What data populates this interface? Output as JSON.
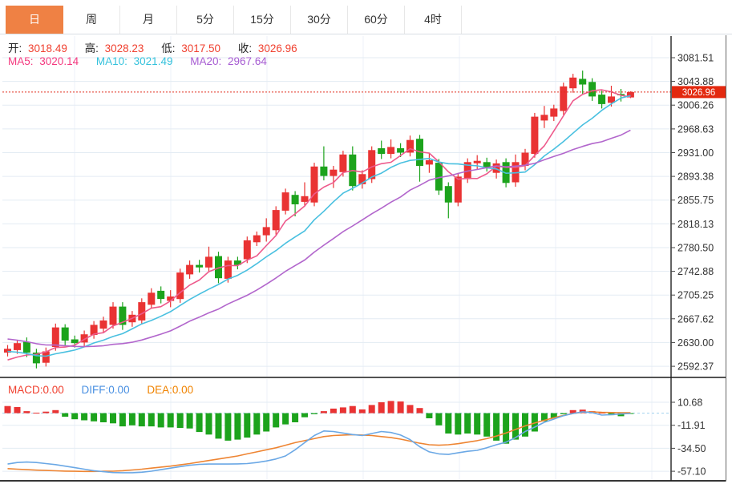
{
  "tabs": [
    {
      "name": "tab-day",
      "label": "日",
      "active": true
    },
    {
      "name": "tab-week",
      "label": "周",
      "active": false
    },
    {
      "name": "tab-month",
      "label": "月",
      "active": false
    },
    {
      "name": "tab-5min",
      "label": "5分",
      "active": false
    },
    {
      "name": "tab-15min",
      "label": "15分",
      "active": false
    },
    {
      "name": "tab-30min",
      "label": "30分",
      "active": false
    },
    {
      "name": "tab-60min",
      "label": "60分",
      "active": false
    },
    {
      "name": "tab-4hour",
      "label": "4时",
      "active": false
    }
  ],
  "info": {
    "ohlc": [
      {
        "label": "开:",
        "value": "3018.49"
      },
      {
        "label": "高:",
        "value": "3028.23"
      },
      {
        "label": "低:",
        "value": "3017.50"
      },
      {
        "label": "收:",
        "value": "3026.96"
      }
    ],
    "ma": [
      {
        "label": "MA5:",
        "value": "3020.14"
      },
      {
        "label": "MA10:",
        "value": "3021.49"
      },
      {
        "label": "MA20:",
        "value": "2967.64"
      }
    ]
  },
  "colors": {
    "tab_active": "#ef8144",
    "up": "#e93333",
    "down": "#1ca31c",
    "ohlc_value": "#f0402f",
    "ma5": "#f4387e",
    "ma10": "#35c2dc",
    "ma20": "#a65bd2",
    "ma5_line": "#ee5a8c",
    "ma10_line": "#49c0e0",
    "ma20_line": "#b266cc",
    "macd_label": "#f0402f",
    "diff_label": "#4a90e2",
    "dea_label": "#f08300",
    "diff_line": "#6ba8e5",
    "dea_line": "#ee8533",
    "price_line": "#e22f1e",
    "badge_bg": "#e3290f",
    "grid": "#e3ebf3",
    "vgrid": "#edf2f8",
    "zero_dash": "#9fd0ee",
    "axis_text": "#333333",
    "border": "#1a1a1a"
  },
  "chart_data": {
    "type": "candlestick+macd",
    "title": "",
    "main": {
      "y_axis_labels": [
        "3081.51",
        "3043.88",
        "3006.26",
        "2968.63",
        "2931.00",
        "2893.38",
        "2855.75",
        "2818.13",
        "2780.50",
        "2742.88",
        "2705.25",
        "2667.62",
        "2630.00",
        "2592.37"
      ],
      "ylim": [
        2592.37,
        3081.51
      ],
      "last_price": "3026.96",
      "last_price_value": 3026.96,
      "ma_series": [
        {
          "name": "MA5",
          "period": 5,
          "value": "3020.14"
        },
        {
          "name": "MA10",
          "period": 10,
          "value": "3021.49"
        },
        {
          "name": "MA20",
          "period": 20,
          "value": "2967.64"
        }
      ],
      "prehistory_closes": [
        2664,
        2662,
        2660,
        2658,
        2656,
        2654,
        2652,
        2650,
        2648,
        2646,
        2642,
        2636,
        2630,
        2624,
        2616,
        2606,
        2598,
        2592,
        2596
      ],
      "candles_format": [
        "open",
        "close",
        "low",
        "high"
      ],
      "candles": [
        [
          2614,
          2620,
          2608,
          2626
        ],
        [
          2618,
          2629,
          2612,
          2634
        ],
        [
          2631,
          2614,
          2607,
          2638
        ],
        [
          2614,
          2597,
          2589,
          2620
        ],
        [
          2598,
          2616,
          2592,
          2622
        ],
        [
          2623,
          2654,
          2617,
          2660
        ],
        [
          2654,
          2633,
          2625,
          2659
        ],
        [
          2635,
          2629,
          2622,
          2641
        ],
        [
          2630,
          2643,
          2624,
          2649
        ],
        [
          2642,
          2658,
          2636,
          2664
        ],
        [
          2652,
          2665,
          2646,
          2671
        ],
        [
          2658,
          2687,
          2652,
          2694
        ],
        [
          2687,
          2658,
          2650,
          2694
        ],
        [
          2662,
          2674,
          2655,
          2680
        ],
        [
          2665,
          2694,
          2659,
          2700
        ],
        [
          2690,
          2709,
          2684,
          2716
        ],
        [
          2712,
          2699,
          2692,
          2719
        ],
        [
          2696,
          2703,
          2686,
          2713
        ],
        [
          2699,
          2741,
          2693,
          2747
        ],
        [
          2738,
          2753,
          2731,
          2760
        ],
        [
          2753,
          2749,
          2741,
          2761
        ],
        [
          2749,
          2766,
          2743,
          2782
        ],
        [
          2767,
          2732,
          2724,
          2774
        ],
        [
          2731,
          2760,
          2725,
          2766
        ],
        [
          2760,
          2753,
          2746,
          2766
        ],
        [
          2762,
          2792,
          2756,
          2798
        ],
        [
          2789,
          2800,
          2783,
          2806
        ],
        [
          2800,
          2813,
          2790,
          2827
        ],
        [
          2808,
          2840,
          2801,
          2846
        ],
        [
          2839,
          2868,
          2833,
          2874
        ],
        [
          2864,
          2849,
          2830,
          2870
        ],
        [
          2853,
          2862,
          2847,
          2884
        ],
        [
          2852,
          2909,
          2846,
          2915
        ],
        [
          2909,
          2894,
          2887,
          2941
        ],
        [
          2894,
          2904,
          2875,
          2910
        ],
        [
          2900,
          2928,
          2893,
          2934
        ],
        [
          2928,
          2878,
          2871,
          2941
        ],
        [
          2881,
          2897,
          2874,
          2903
        ],
        [
          2889,
          2935,
          2883,
          2941
        ],
        [
          2938,
          2929,
          2921,
          2950
        ],
        [
          2929,
          2940,
          2922,
          2952
        ],
        [
          2938,
          2931,
          2924,
          2946
        ],
        [
          2931,
          2951,
          2925,
          2958
        ],
        [
          2953,
          2910,
          2885,
          2959
        ],
        [
          2912,
          2919,
          2899,
          2931
        ],
        [
          2915,
          2871,
          2864,
          2921
        ],
        [
          2878,
          2852,
          2827,
          2884
        ],
        [
          2852,
          2893,
          2846,
          2899
        ],
        [
          2889,
          2916,
          2883,
          2922
        ],
        [
          2914,
          2918,
          2905,
          2927
        ],
        [
          2916,
          2908,
          2901,
          2923
        ],
        [
          2899,
          2914,
          2890,
          2920
        ],
        [
          2916,
          2883,
          2876,
          2922
        ],
        [
          2884,
          2916,
          2877,
          2928
        ],
        [
          2910,
          2931,
          2903,
          2937
        ],
        [
          2929,
          2988,
          2923,
          2994
        ],
        [
          2982,
          2991,
          2970,
          3005
        ],
        [
          2988,
          3001,
          2981,
          3007
        ],
        [
          2997,
          3036,
          2991,
          3042
        ],
        [
          3033,
          3050,
          3026,
          3056
        ],
        [
          3048,
          3039,
          3024,
          3061
        ],
        [
          3043,
          3020,
          3013,
          3049
        ],
        [
          3023,
          3008,
          3001,
          3029
        ],
        [
          3010,
          3020,
          3004,
          3037
        ],
        [
          3024,
          3022,
          3012,
          3032
        ],
        [
          3018.49,
          3026.96,
          3017.5,
          3028.23
        ]
      ]
    },
    "macd": {
      "legend": [
        {
          "label": "MACD:",
          "value": "0.00"
        },
        {
          "label": "DIFF:",
          "value": "0.00"
        },
        {
          "label": "DEA:",
          "value": "0.00"
        }
      ],
      "y_axis_labels": [
        "10.68",
        "-11.91",
        "-34.50",
        "-57.10"
      ],
      "histogram": [
        7,
        6,
        2,
        0.5,
        1.5,
        3,
        -3.5,
        -6,
        -7,
        -8,
        -9,
        -10,
        -13,
        -12,
        -13,
        -13,
        -14,
        -14,
        -14.5,
        -15,
        -18.5,
        -21,
        -25,
        -27,
        -26,
        -24,
        -21,
        -18,
        -14,
        -11,
        -9,
        -4,
        -1,
        2,
        4.5,
        5.7,
        7,
        3.7,
        8,
        10.7,
        12,
        11.5,
        8,
        5,
        -5,
        -12,
        -20,
        -21,
        -20,
        -21,
        -23,
        -27,
        -30,
        -26,
        -23,
        -18,
        -8,
        -5,
        -1,
        3,
        3.5,
        2,
        0.5,
        -2,
        -3,
        -0.5
      ],
      "diff": [
        -50,
        -48.5,
        -48,
        -48.5,
        -49.5,
        -50.5,
        -52,
        -53.5,
        -55,
        -56.5,
        -57.5,
        -58.3,
        -58.5,
        -58.5,
        -58,
        -57,
        -55.5,
        -54,
        -52.5,
        -51.2,
        -50.3,
        -50,
        -50,
        -50,
        -49.8,
        -49.5,
        -48.5,
        -47,
        -45,
        -42,
        -36,
        -29,
        -22,
        -17.5,
        -18,
        -19.5,
        -21,
        -22,
        -20,
        -18,
        -19,
        -21.5,
        -26,
        -33,
        -38,
        -40,
        -40.5,
        -39,
        -37.5,
        -36.5,
        -34,
        -31,
        -28.5,
        -24,
        -18,
        -13.7,
        -9,
        -5.8,
        -2.5,
        -0.3,
        1.3,
        0.5,
        -1.9,
        -1.5,
        -0.8,
        -0.3
      ],
      "dea": [
        -54.5,
        -55,
        -55.5,
        -56,
        -56.3,
        -56.6,
        -56.9,
        -57.1,
        -57.2,
        -57.2,
        -57.1,
        -57,
        -56.5,
        -55.8,
        -55,
        -54,
        -53,
        -52,
        -50.8,
        -49.5,
        -48,
        -46.5,
        -45,
        -43.5,
        -42,
        -40,
        -38,
        -36,
        -34,
        -31.5,
        -29,
        -27,
        -25,
        -23,
        -22,
        -21.5,
        -21.2,
        -21.5,
        -22,
        -23,
        -24,
        -25.5,
        -27.5,
        -29.5,
        -31,
        -31.5,
        -31,
        -30,
        -28.5,
        -27,
        -25,
        -22.5,
        -19.5,
        -16,
        -12.5,
        -9.7,
        -7,
        -4.5,
        -2.2,
        -0.3,
        1,
        1.2,
        0.8,
        0.6,
        0.5,
        0.5
      ]
    }
  }
}
